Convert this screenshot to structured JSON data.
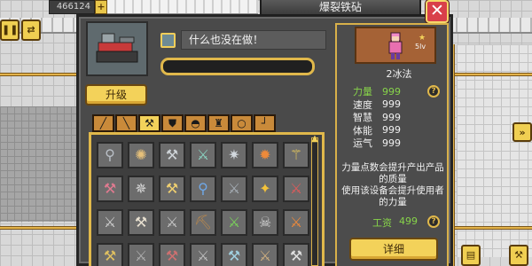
{
  "topbar": {
    "coins": "466124",
    "plus_label": "+"
  },
  "window": {
    "title": "爆裂铁砧",
    "close_label": "✕"
  },
  "machine": {
    "status_text": "什么也没在做！",
    "progress_fraction": 0.0,
    "upgrade_label": "升级"
  },
  "tabs": [
    {
      "icon": "sword-icon",
      "glyph": "╱"
    },
    {
      "icon": "spear-icon",
      "glyph": "╲"
    },
    {
      "icon": "axe-icon",
      "glyph": "⚒"
    },
    {
      "icon": "shield-icon",
      "glyph": "⛊"
    },
    {
      "icon": "helmet-icon",
      "glyph": "◓"
    },
    {
      "icon": "armor-icon",
      "glyph": "♜"
    },
    {
      "icon": "ring-icon",
      "glyph": "○"
    },
    {
      "icon": "boot-icon",
      "glyph": "┘"
    }
  ],
  "items": [
    {
      "icon": "mace-icon",
      "glyph": "⚲",
      "color": "#b9bfc6"
    },
    {
      "icon": "spiked-club-icon",
      "glyph": "✺",
      "color": "#e6c07a"
    },
    {
      "icon": "war-hammer-icon",
      "glyph": "⚒",
      "color": "#cfd4d8"
    },
    {
      "icon": "axe-icon",
      "glyph": "⚔",
      "color": "#8bd6c4"
    },
    {
      "icon": "morning-star-icon",
      "glyph": "✷",
      "color": "#d2d8de"
    },
    {
      "icon": "fire-scepter-icon",
      "glyph": "✹",
      "color": "#ee8a3a"
    },
    {
      "icon": "golden-staff-icon",
      "glyph": "⚚",
      "color": "#f3d25a"
    },
    {
      "icon": "crystal-hammer-icon",
      "glyph": "⚒",
      "color": "#e07a90"
    },
    {
      "icon": "spiked-mace-icon",
      "glyph": "✵",
      "color": "#d8d8d8"
    },
    {
      "icon": "gold-hammer-icon",
      "glyph": "⚒",
      "color": "#f0d070"
    },
    {
      "icon": "orb-scepter-icon",
      "glyph": "⚲",
      "color": "#6fa8e8"
    },
    {
      "icon": "battle-axe-icon",
      "glyph": "⚔",
      "color": "#a8b0b8"
    },
    {
      "icon": "winged-hammer-icon",
      "glyph": "✦",
      "color": "#f3c23a"
    },
    {
      "icon": "red-axe-icon",
      "glyph": "⚔",
      "color": "#e05a5a"
    },
    {
      "icon": "great-axe-icon",
      "glyph": "⚔",
      "color": "#d0d0d0"
    },
    {
      "icon": "halberd-icon",
      "glyph": "⚒",
      "color": "#e8e0d0"
    },
    {
      "icon": "double-axe-icon",
      "glyph": "⚔",
      "color": "#c8c8c8"
    },
    {
      "icon": "pickaxe-icon",
      "glyph": "⛏",
      "color": "#c08a4a"
    },
    {
      "icon": "green-axe-icon",
      "glyph": "⚔",
      "color": "#7ad45a"
    },
    {
      "icon": "skull-axe-icon",
      "glyph": "☠",
      "color": "#d8d8d8"
    },
    {
      "icon": "flame-axe-icon",
      "glyph": "⚔",
      "color": "#f08a3a"
    },
    {
      "icon": "item-22-icon",
      "glyph": "⚒",
      "color": "#e0c060"
    },
    {
      "icon": "item-23-icon",
      "glyph": "⚔",
      "color": "#b0b0b0"
    },
    {
      "icon": "item-24-icon",
      "glyph": "⚒",
      "color": "#d07070"
    },
    {
      "icon": "item-25-icon",
      "glyph": "⚔",
      "color": "#c0c0c0"
    },
    {
      "icon": "item-26-icon",
      "glyph": "⚒",
      "color": "#a0d0e0"
    },
    {
      "icon": "item-27-icon",
      "glyph": "⚔",
      "color": "#d0b080"
    },
    {
      "icon": "item-28-icon",
      "glyph": "⚒",
      "color": "#e0e0e0"
    }
  ],
  "worker": {
    "name": "2冰法",
    "level": "5lv",
    "stats": [
      {
        "name": "力量",
        "value": "999",
        "highlight": true
      },
      {
        "name": "速度",
        "value": "999",
        "highlight": false
      },
      {
        "name": "智慧",
        "value": "999",
        "highlight": false
      },
      {
        "name": "体能",
        "value": "999",
        "highlight": false
      },
      {
        "name": "运气",
        "value": "999",
        "highlight": false
      }
    ],
    "help_label": "?",
    "description": "力量点数会提升产出产品的质量\n使用该设备会提升使用者的力量",
    "wage_label": "工资",
    "wage_value": "499",
    "detail_label": "详细"
  },
  "side_buttons": {
    "pause_icon": "pause-icon",
    "pause_glyph": "❚❚",
    "swap_icon": "swap-icon",
    "swap_glyph": "⇄",
    "right_arrow_icon": "double-chevron-right-icon",
    "right_arrow_glyph": "»",
    "book_icon": "book-icon",
    "book_glyph": "▤"
  },
  "colors": {
    "accent_gold": "#e0b84b",
    "panel": "#4a4a4a",
    "highlight_green": "#87d34a",
    "close_red": "#d9404a"
  }
}
